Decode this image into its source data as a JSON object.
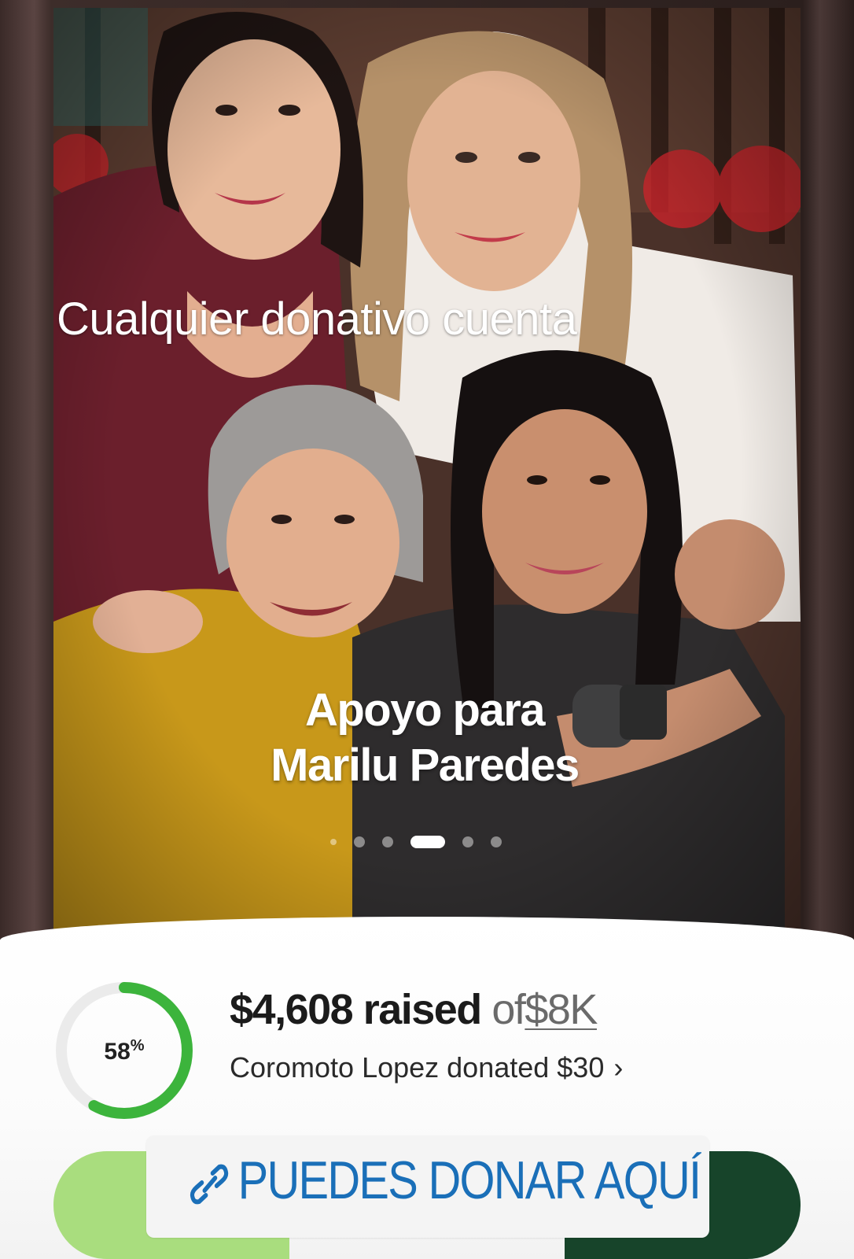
{
  "photo": {
    "caption": "Cualquier donativo cuenta",
    "campaign_title_line1": "Apoyo para",
    "campaign_title_line2": "Marilu Paredes",
    "carousel_dots": 6,
    "active_dot": 3
  },
  "progress": {
    "percent_label": "58",
    "percent_sign": "%",
    "fraction": 0.58,
    "amount": "$4,608",
    "raised_word": "raised",
    "of_word": "of",
    "goal": "$8K",
    "donor_text": "Coromoto Lopez donated $30",
    "chevron": "›"
  },
  "cta": {
    "label": "PUEDES DONAR AQUÍ",
    "icon": "link-icon"
  },
  "colors": {
    "ring_green": "#3cb43c",
    "ring_track": "#e8e8e8",
    "cta_text": "#1a6fb8",
    "btn_left": "#a9dd7e",
    "btn_right": "#17442a"
  }
}
